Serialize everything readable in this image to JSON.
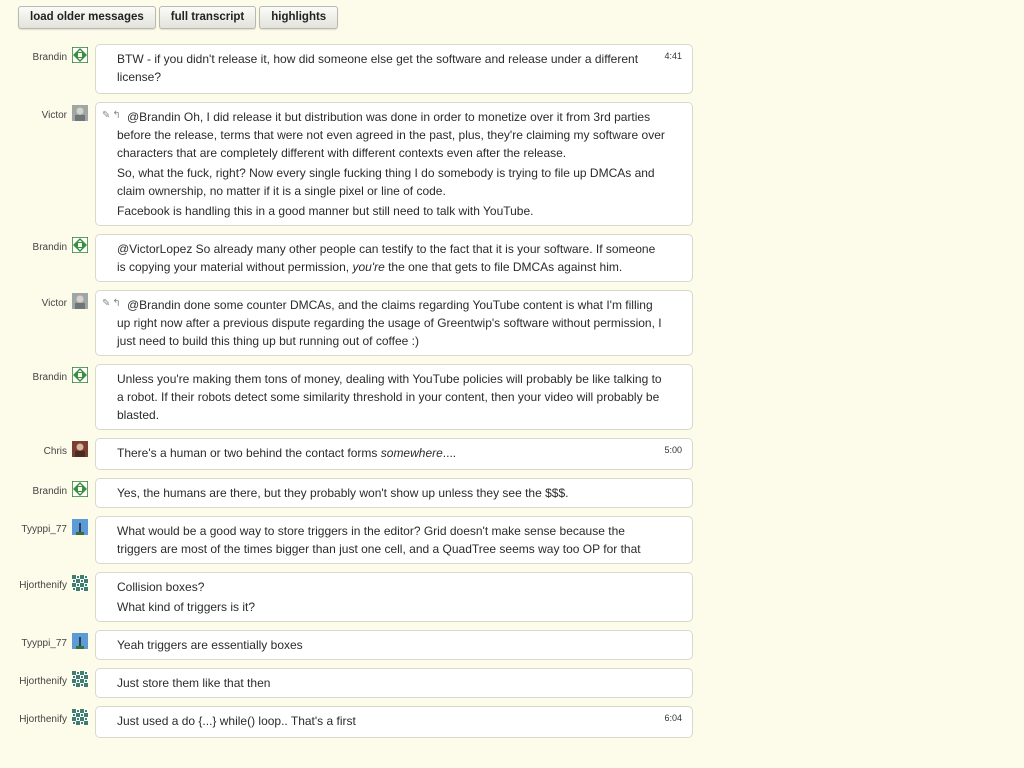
{
  "toolbar": {
    "load_older": "load older messages",
    "full_transcript": "full transcript",
    "highlights": "highlights"
  },
  "icons": {
    "edit": "✎",
    "reply": "↰"
  },
  "messages": [
    {
      "user": "Brandin",
      "avatar": "green-diamond-identicon",
      "time": "4:41",
      "lines": [
        "BTW - if you didn't release it, how did someone else get the software and release under a different license?"
      ]
    },
    {
      "user": "Victor",
      "avatar": "photo-avatar",
      "time": "",
      "reply": true,
      "lines": [
        "@Brandin Oh, I did release it but distribution was done in order to monetize over it from 3rd parties before the release, terms that were not even agreed in the past, plus, they're claiming my software over characters that are completely different with different contexts even after the release.",
        "So, what the fuck, right? Now every single fucking thing I do somebody is trying to file up DMCAs and claim ownership, no matter if it is a single pixel or line of code.",
        "Facebook is handling this in a good manner but still need to talk with YouTube."
      ]
    },
    {
      "user": "Brandin",
      "avatar": "green-diamond-identicon",
      "time": "",
      "lines_rich": [
        {
          "pre": "@VictorLopez So already many other people can testify to the fact that it is your software. If someone is copying your material without permission, ",
          "em": "you're",
          "post": " the one that gets to file DMCAs against him."
        }
      ]
    },
    {
      "user": "Victor",
      "avatar": "photo-avatar",
      "time": "",
      "reply": true,
      "lines": [
        "@Brandin done some counter DMCAs, and the claims regarding YouTube content is what I'm filling up right now after a previous dispute regarding the usage of Greentwip's software without permission, I just need to build this thing up but running out of coffee :)"
      ]
    },
    {
      "user": "Brandin",
      "avatar": "green-diamond-identicon",
      "time": "",
      "lines": [
        "Unless you're making them tons of money, dealing with YouTube policies will probably be like talking to a robot. If their robots detect some similarity threshold in your content, then your video will probably be blasted."
      ]
    },
    {
      "user": "Chris",
      "avatar": "photo-avatar-red",
      "time": "5:00",
      "lines_rich": [
        {
          "pre": "There's a human or two behind the contact forms ",
          "em": "somewhere",
          "post": "...."
        }
      ]
    },
    {
      "user": "Brandin",
      "avatar": "green-diamond-identicon",
      "time": "",
      "lines": [
        "Yes, the humans are there, but they probably won't show up unless they see the $$$."
      ]
    },
    {
      "user": "Tyyppi_77",
      "avatar": "blue-sky-avatar",
      "time": "",
      "lines": [
        "What would be a good way to store triggers in the editor? Grid doesn't make sense because the triggers are most of the times bigger than just one cell, and a QuadTree seems way too OP for that"
      ]
    },
    {
      "user": "Hjorthenify",
      "avatar": "green-pattern-identicon",
      "time": "",
      "lines": [
        "Collision boxes?",
        "What kind of triggers is it?"
      ]
    },
    {
      "user": "Tyyppi_77",
      "avatar": "blue-sky-avatar",
      "time": "",
      "lines": [
        "Yeah triggers are essentially boxes"
      ]
    },
    {
      "user": "Hjorthenify",
      "avatar": "green-pattern-identicon",
      "time": "",
      "lines": [
        "Just store them like that then"
      ]
    },
    {
      "user": "Hjorthenify",
      "avatar": "green-pattern-identicon",
      "time": "6:04",
      "lines": [
        "Just used a do {...} while() loop.. That's a first"
      ]
    }
  ]
}
